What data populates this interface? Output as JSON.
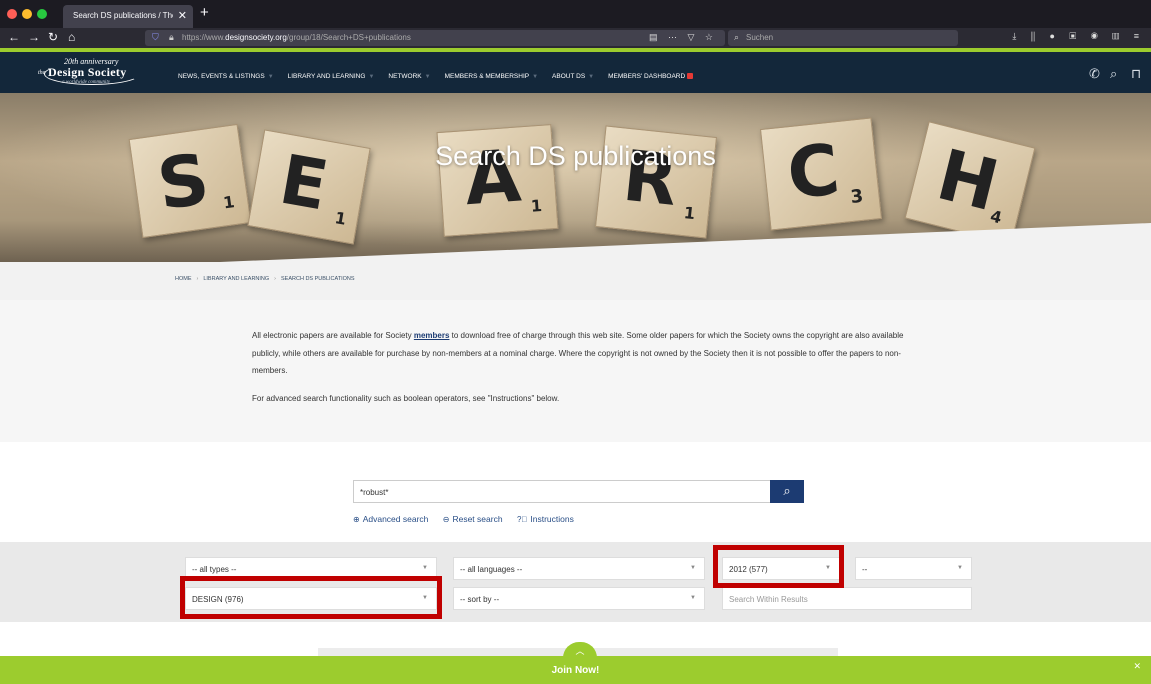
{
  "browser": {
    "tab_title": "Search DS publications / The D",
    "tab_close": "✕",
    "new_tab": "+",
    "url_prefix": "https://www.",
    "url_domain": "designsociety.org",
    "url_path": "/group/18/Search+DS+publications",
    "url_tools": "▤ ⋯ ▽ ☆",
    "search_placeholder": "Suchen",
    "extension_icons": "⤓ ⫼ ● ▣ ◉ ▥ ≡"
  },
  "site": {
    "logo_anniversary": "20th anniversary",
    "logo_the": "the",
    "logo_name": "Design Society",
    "logo_tagline": "a worldwide community",
    "nav": [
      {
        "label": "NEWS, EVENTS & LISTINGS"
      },
      {
        "label": "LIBRARY AND LEARNING"
      },
      {
        "label": "NETWORK"
      },
      {
        "label": "MEMBERS & MEMBERSHIP"
      },
      {
        "label": "ABOUT DS"
      },
      {
        "label": "MEMBERS' DASHBOARD"
      }
    ]
  },
  "hero": {
    "title": "Search DS publications",
    "tiles": [
      {
        "letter": "S",
        "sub": "1"
      },
      {
        "letter": "E",
        "sub": "1"
      },
      {
        "letter": "A",
        "sub": "1"
      },
      {
        "letter": "R",
        "sub": "1"
      },
      {
        "letter": "C",
        "sub": "3"
      },
      {
        "letter": "H",
        "sub": "4"
      }
    ]
  },
  "breadcrumb": {
    "home": "HOME",
    "library": "LIBRARY AND LEARNING",
    "current": "SEARCH DS PUBLICATIONS"
  },
  "intro": {
    "p1_before": "All electronic papers are available for Society ",
    "p1_link": "members",
    "p1_after": " to download free of charge through this web site. Some older papers for which the Society owns the copyright are also available publicly, while others are available for purchase by non-members at a nominal charge. Where the copyright is not owned by the Society then it is not possible to offer the papers to non-members.",
    "p2": "For advanced search functionality such as boolean operators, see \"Instructions\" below."
  },
  "search": {
    "query": "*robust*",
    "advanced": "Advanced search",
    "reset": "Reset search",
    "instructions": "Instructions"
  },
  "filters": {
    "types": "-- all types --",
    "languages": "-- all languages --",
    "year": "2012 (577)",
    "year_to": "--",
    "design": "DESIGN (976)",
    "sort": "-- sort by --",
    "within_placeholder": "Search Within Results",
    "highlight_color": "#c00000"
  },
  "join": {
    "label": "Join Now!",
    "close": "✕"
  }
}
